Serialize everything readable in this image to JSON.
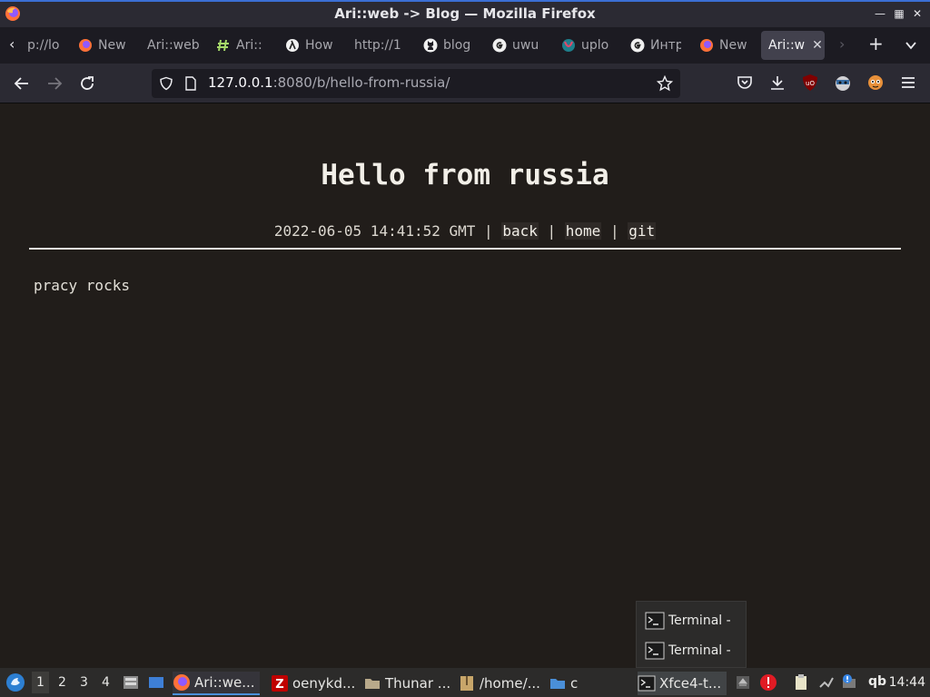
{
  "window": {
    "title": "Ari::web -> Blog — Mozilla Firefox"
  },
  "tabs": [
    {
      "label": "p://lo",
      "icon": "none"
    },
    {
      "label": "New",
      "icon": "firefox-icon"
    },
    {
      "label": "Ari::web",
      "icon": "none"
    },
    {
      "label": "Ari::",
      "icon": "hash-icon"
    },
    {
      "label": "How",
      "icon": "lambda-icon"
    },
    {
      "label": "http://1",
      "icon": "none"
    },
    {
      "label": "blog",
      "icon": "github-icon"
    },
    {
      "label": "uwu",
      "icon": "google-icon"
    },
    {
      "label": "uplo",
      "icon": "upload-icon"
    },
    {
      "label": "Интр",
      "icon": "google-icon"
    },
    {
      "label": "New",
      "icon": "firefox-icon"
    },
    {
      "label": "Ari::w",
      "icon": "none",
      "active": true
    }
  ],
  "urlbar": {
    "url_host": "127.0.0.1",
    "url_rest": ":8080/b/hello-from-russia/"
  },
  "page": {
    "title": "Hello from russia",
    "date": "2022-06-05 14:41:52 GMT",
    "sep": "|",
    "links": {
      "back": "back",
      "home": "home",
      "git": "git"
    },
    "body": "pracy rocks"
  },
  "popup": {
    "items": [
      "Terminal -",
      "Terminal -"
    ]
  },
  "taskbar": {
    "workspaces": [
      "1",
      "2",
      "3",
      "4"
    ],
    "items": [
      "Ari::we...",
      "oenykd...",
      "Thunar ...",
      "/home/...",
      "c",
      "Xfce4-t..."
    ],
    "tray_text": "qb",
    "clock": "14:44"
  }
}
